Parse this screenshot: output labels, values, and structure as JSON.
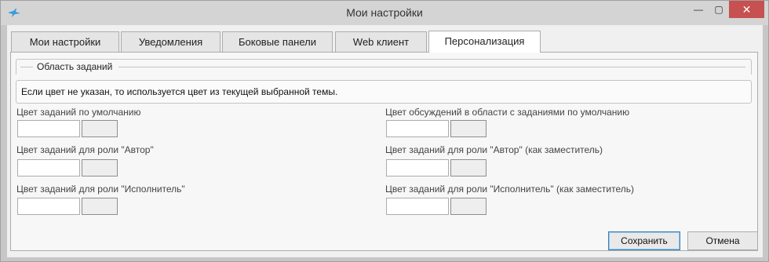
{
  "window": {
    "title": "Мои настройки",
    "minimize": "—",
    "maximize": "▢",
    "close": "✕"
  },
  "tabs": [
    {
      "label": "Мои настройки"
    },
    {
      "label": "Уведомления"
    },
    {
      "label": "Боковые панели"
    },
    {
      "label": "Web клиент"
    },
    {
      "label": "Персонализация",
      "active": true
    }
  ],
  "group": {
    "title": "Область заданий",
    "notice": "Если цвет не указан, то используется цвет из текущей выбранной темы."
  },
  "fields_left": [
    {
      "label": "Цвет заданий по умолчанию",
      "value": ""
    },
    {
      "label": "Цвет заданий для роли \"Автор\"",
      "value": ""
    },
    {
      "label": "Цвет заданий для роли \"Исполнитель\"",
      "value": ""
    }
  ],
  "fields_right": [
    {
      "label": "Цвет обсуждений в области с заданиями по умолчанию",
      "value": ""
    },
    {
      "label": "Цвет заданий для роли \"Автор\" (как заместитель)",
      "value": ""
    },
    {
      "label": "Цвет заданий для роли \"Исполнитель\" (как заместитель)",
      "value": ""
    }
  ],
  "footer": {
    "save_label": "Сохранить",
    "cancel_label": "Отмена"
  },
  "colors": {
    "close_button": "#c75050",
    "accent": "#3c7fb1"
  },
  "icons": {
    "app": "bird-logo-icon"
  }
}
